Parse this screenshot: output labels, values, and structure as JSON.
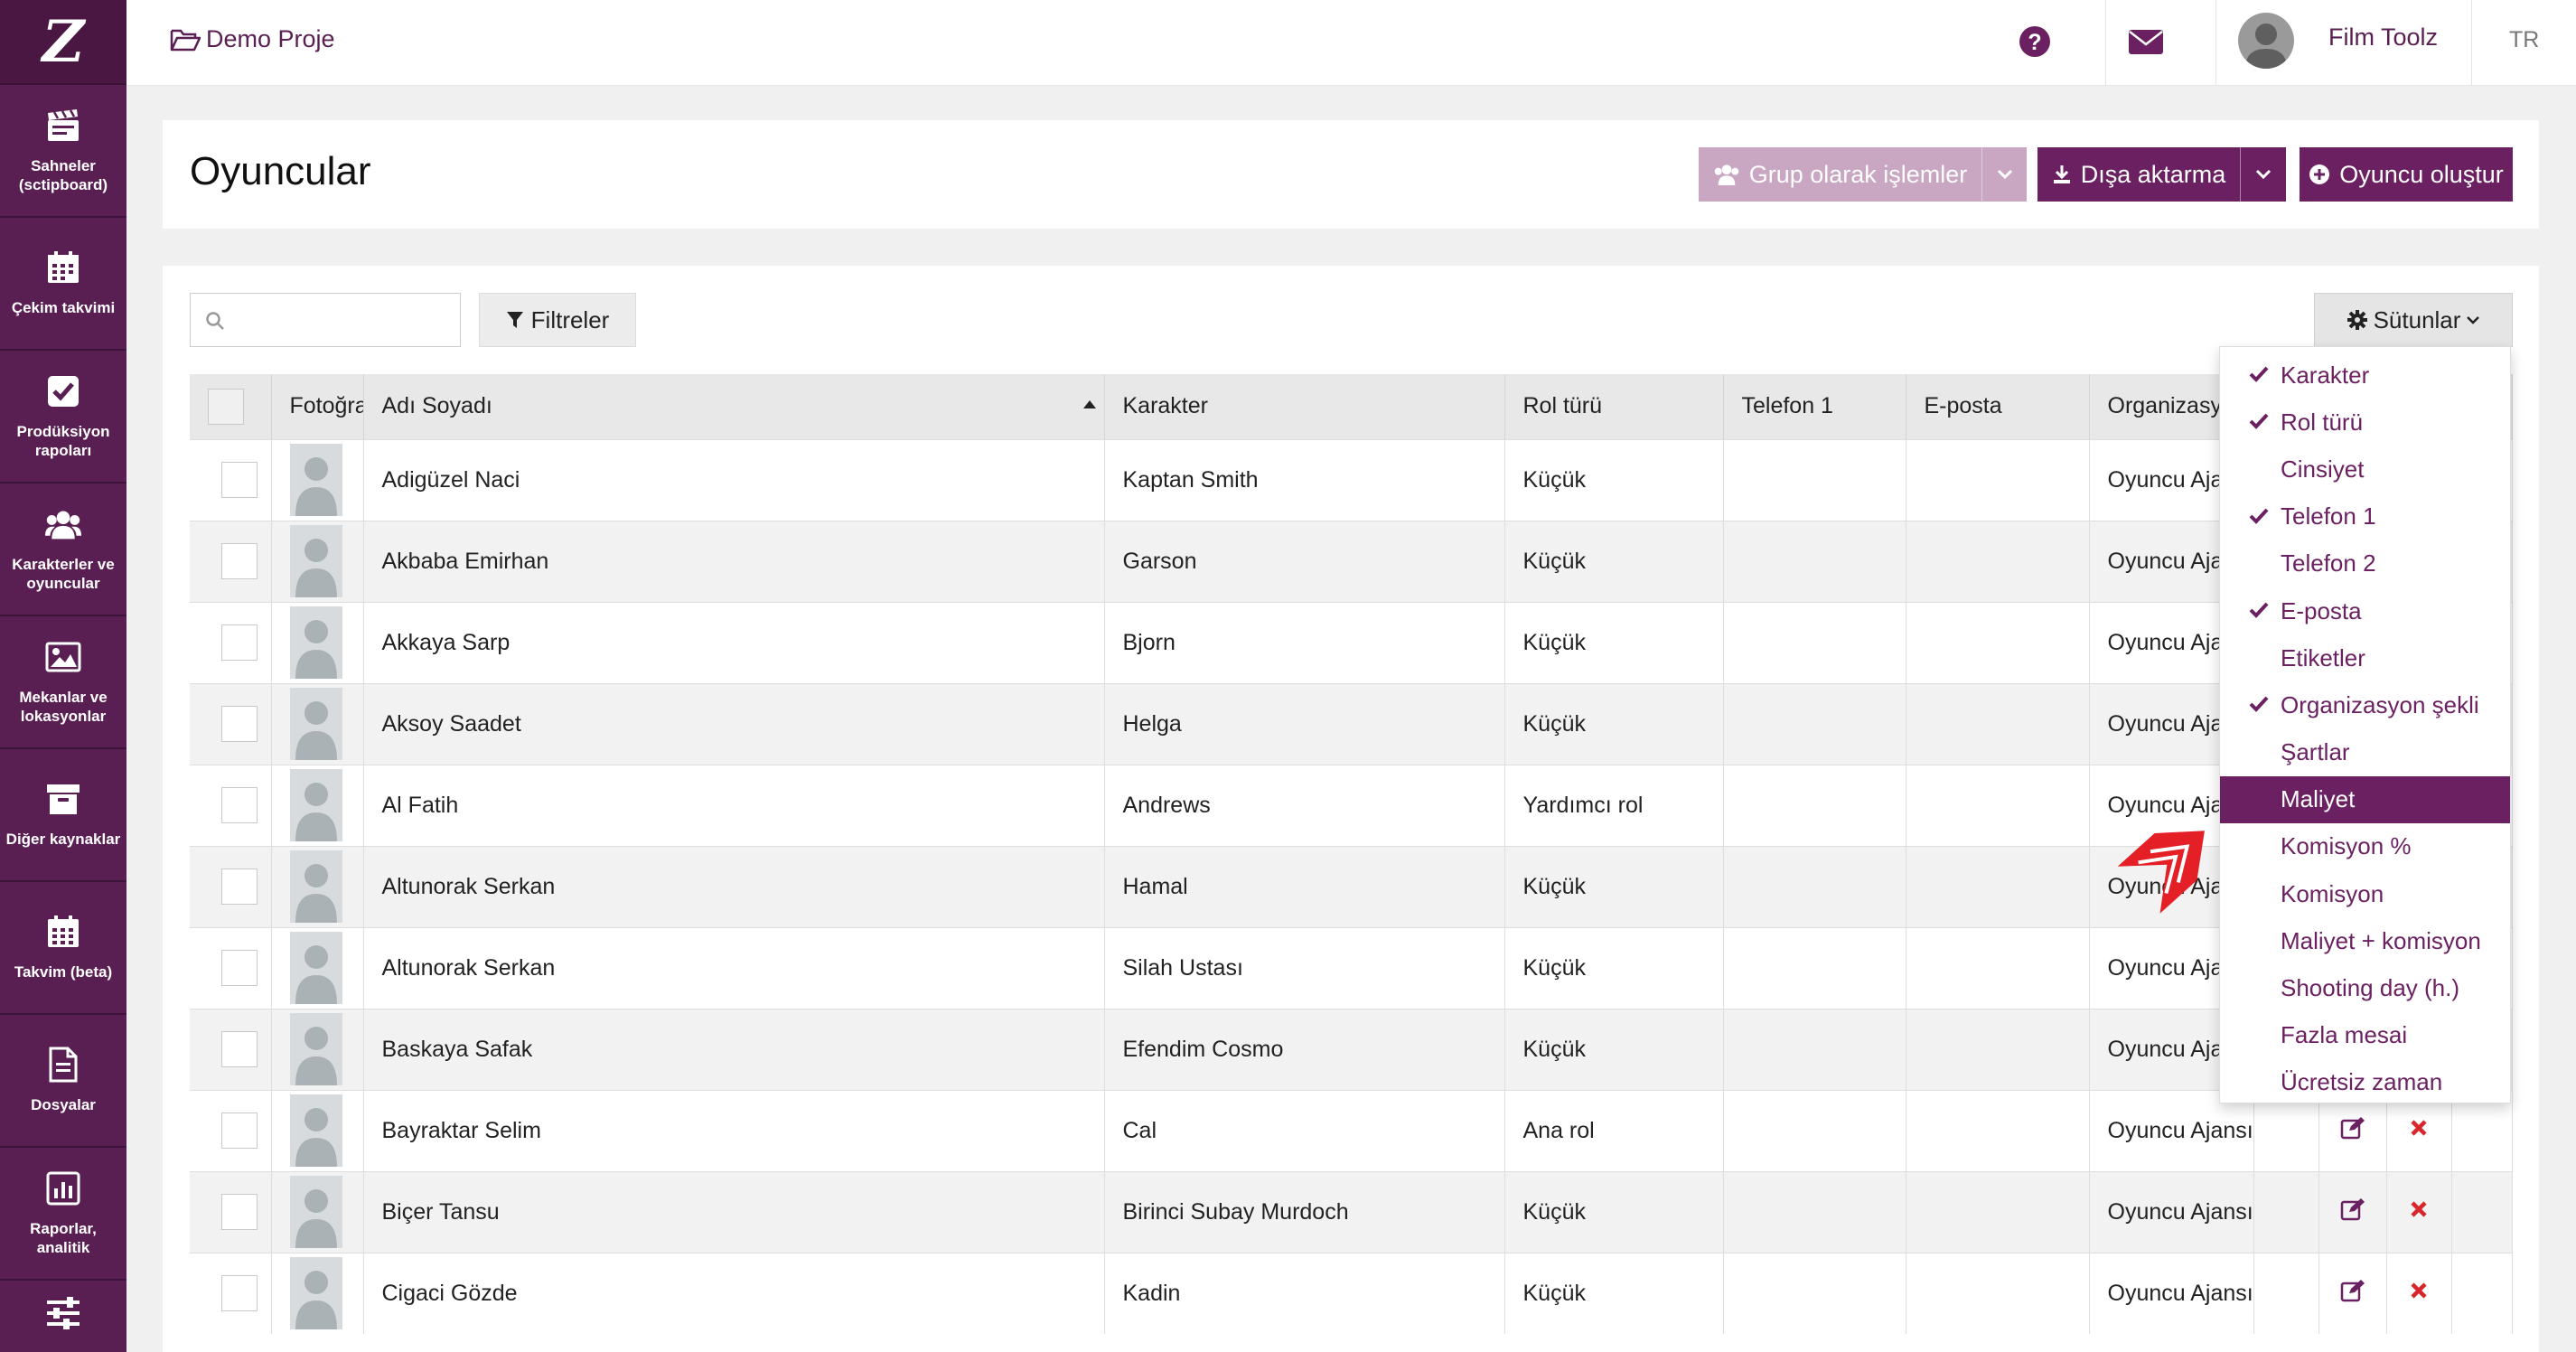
{
  "sidebar": {
    "logo": "Z",
    "items": [
      {
        "label": "Sahneler (sctipboard)",
        "icon": "clapperboard-icon"
      },
      {
        "label": "Çekim takvimi",
        "icon": "calendar-icon"
      },
      {
        "label": "Prodüksiyon rapoları",
        "icon": "checkbox-icon"
      },
      {
        "label": "Karakterler ve oyuncular",
        "icon": "users-icon"
      },
      {
        "label": "Mekanlar ve lokasyonlar",
        "icon": "image-icon"
      },
      {
        "label": "Diğer kaynaklar",
        "icon": "archive-icon"
      },
      {
        "label": "Takvim (beta)",
        "icon": "calendar-grid-icon"
      },
      {
        "label": "Dosyalar",
        "icon": "file-icon"
      },
      {
        "label": "Raporlar, analitik",
        "icon": "bar-chart-icon"
      },
      {
        "label": "",
        "icon": "sliders-icon"
      }
    ]
  },
  "topbar": {
    "project": "Demo Proje",
    "user_name": "Film Toolz",
    "language": "TR"
  },
  "header": {
    "title": "Oyuncular",
    "group_actions": "Grup olarak işlemler",
    "export": "Dışa aktarma",
    "create": "Oyuncu oluştur"
  },
  "toolbar": {
    "search_placeholder": "",
    "filters": "Filtreler",
    "columns": "Sütunlar"
  },
  "table": {
    "headers": [
      "Fotoğraf",
      "Adı Soyadı",
      "Karakter",
      "Rol türü",
      "Telefon 1",
      "E-posta",
      "Organizasyon şekli"
    ],
    "rows": [
      {
        "name": "Adigüzel Naci",
        "character": "Kaptan Smith",
        "role": "Küçük",
        "phone": "",
        "email": "",
        "org": "Oyuncu Ajansı"
      },
      {
        "name": "Akbaba Emirhan",
        "character": "Garson",
        "role": "Küçük",
        "phone": "",
        "email": "",
        "org": "Oyuncu Ajansı"
      },
      {
        "name": "Akkaya Sarp",
        "character": "Bjorn",
        "role": "Küçük",
        "phone": "",
        "email": "",
        "org": "Oyuncu Ajansı"
      },
      {
        "name": "Aksoy Saadet",
        "character": "Helga",
        "role": "Küçük",
        "phone": "",
        "email": "",
        "org": "Oyuncu Ajansı"
      },
      {
        "name": "Al Fatih",
        "character": "Andrews",
        "role": "Yardımcı rol",
        "phone": "",
        "email": "",
        "org": "Oyuncu Ajansı"
      },
      {
        "name": "Altunorak Serkan",
        "character": "Hamal",
        "role": "Küçük",
        "phone": "",
        "email": "",
        "org": "Oyuncu Ajansı"
      },
      {
        "name": "Altunorak Serkan",
        "character": "Silah Ustası",
        "role": "Küçük",
        "phone": "",
        "email": "",
        "org": "Oyuncu Ajansı"
      },
      {
        "name": "Baskaya Safak",
        "character": "Efendim Cosmo",
        "role": "Küçük",
        "phone": "",
        "email": "",
        "org": "Oyuncu Ajansı"
      },
      {
        "name": "Bayraktar Selim",
        "character": "Cal",
        "role": "Ana rol",
        "phone": "",
        "email": "",
        "org": "Oyuncu Ajansı"
      },
      {
        "name": "Biçer Tansu",
        "character": "Birinci Subay Murdoch",
        "role": "Küçük",
        "phone": "",
        "email": "",
        "org": "Oyuncu Ajansı"
      },
      {
        "name": "Cigaci Gözde",
        "character": "Kadin",
        "role": "Küçük",
        "phone": "",
        "email": "",
        "org": "Oyuncu Ajansı"
      }
    ]
  },
  "columns_menu": {
    "items": [
      {
        "label": "Karakter",
        "checked": true
      },
      {
        "label": "Rol türü",
        "checked": true
      },
      {
        "label": "Cinsiyet",
        "checked": false
      },
      {
        "label": "Telefon 1",
        "checked": true
      },
      {
        "label": "Telefon 2",
        "checked": false
      },
      {
        "label": "E-posta",
        "checked": true
      },
      {
        "label": "Etiketler",
        "checked": false
      },
      {
        "label": "Organizasyon şekli",
        "checked": true
      },
      {
        "label": "Şartlar",
        "checked": false
      },
      {
        "label": "Maliyet",
        "checked": false,
        "highlighted": true
      },
      {
        "label": "Komisyon %",
        "checked": false
      },
      {
        "label": "Komisyon",
        "checked": false
      },
      {
        "label": "Maliyet + komisyon",
        "checked": false
      },
      {
        "label": "Shooting day (h.)",
        "checked": false
      },
      {
        "label": "Fazla mesai",
        "checked": false
      },
      {
        "label": "Ücretsiz zaman",
        "checked": false
      }
    ]
  },
  "colors": {
    "brand": "#5a1f52",
    "accent": "#6b2161",
    "accent_light": "#c9a6c1",
    "delete": "#d9262c"
  }
}
